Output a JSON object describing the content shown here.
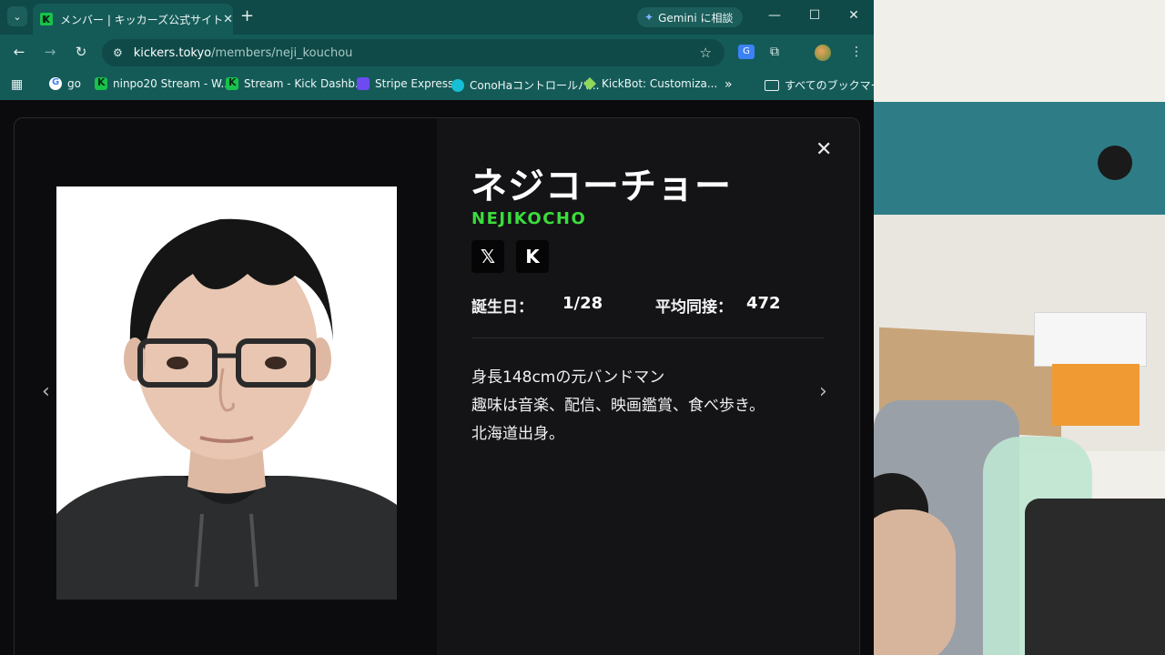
{
  "browser": {
    "tab": {
      "title": "メンバー | キッカーズ公式サイト"
    },
    "gemini_label": "Gemini に相談",
    "address": {
      "host": "kickers.tokyo",
      "path": "/members/neji_kouchou"
    },
    "bookmarks": [
      {
        "label": "go"
      },
      {
        "label": "ninpo20 Stream - W..."
      },
      {
        "label": "Stream - Kick Dashb..."
      },
      {
        "label": "Stripe Express"
      },
      {
        "label": "ConoHaコントロールパ..."
      },
      {
        "label": "KickBot: Customiza..."
      }
    ],
    "all_bookmarks_label": "すべてのブックマーク"
  },
  "member": {
    "name_ja": "ネジコーチョー",
    "name_en": "NEJIKOCHO",
    "birthday_label": "誕生日：",
    "birthday_value": "1/28",
    "avg_viewers_label": "平均同接：",
    "avg_viewers_value": "472",
    "bio_lines": [
      "身長148cmの元バンドマン",
      "趣味は音楽、配信、映画鑑賞、食べ歩き。",
      "北海道出身。"
    ],
    "social": [
      {
        "icon": "x-icon",
        "glyph": "𝕏"
      },
      {
        "icon": "kick-icon",
        "glyph": "K"
      }
    ]
  },
  "icons": {
    "close": "✕",
    "prev": "‹",
    "next": "›"
  },
  "colors": {
    "accent_green": "#3bdc3b",
    "browser_teal": "#145b58"
  }
}
